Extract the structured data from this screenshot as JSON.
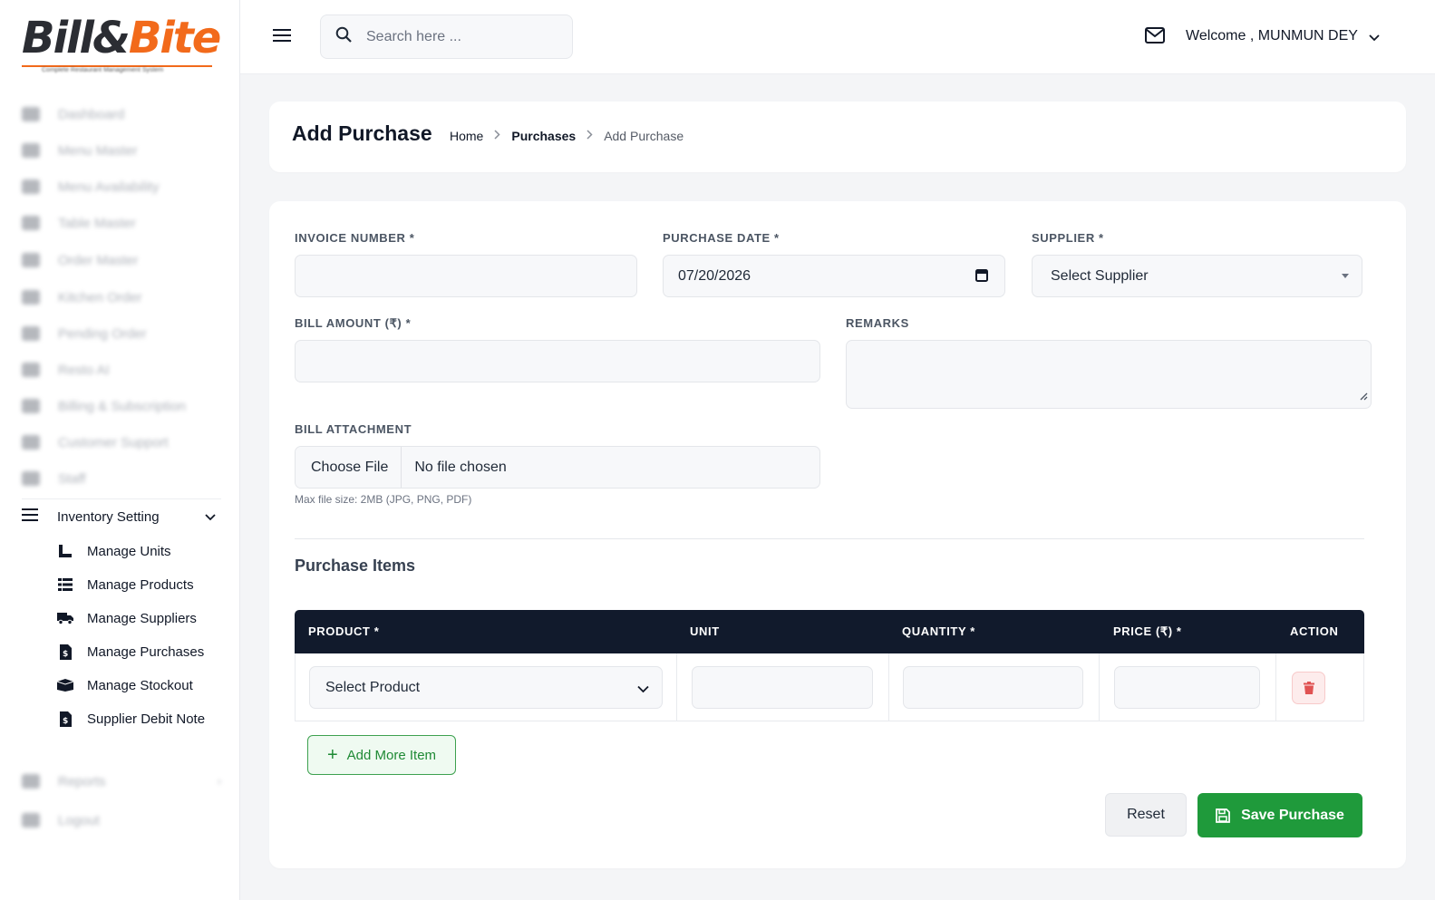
{
  "brand": {
    "word1": "Bill&",
    "word2": "Bite",
    "tagline": "Complete Restaurant Management System"
  },
  "sidebar": {
    "items": [
      {
        "label": "Dashboard",
        "icon": "dashboard-icon"
      },
      {
        "label": "Menu Master",
        "icon": "menu-icon"
      },
      {
        "label": "Menu Availability",
        "icon": "availability-icon"
      },
      {
        "label": "Table Master",
        "icon": "table-icon"
      },
      {
        "label": "Order Master",
        "icon": "order-icon"
      },
      {
        "label": "Kitchen Order",
        "icon": "kitchen-icon"
      },
      {
        "label": "Pending Order",
        "icon": "pending-icon"
      },
      {
        "label": "Resto AI",
        "icon": "ai-icon"
      },
      {
        "label": "Billing & Subscription",
        "icon": "billing-icon"
      },
      {
        "label": "Customer Support",
        "icon": "support-icon"
      },
      {
        "label": "Staff",
        "icon": "staff-icon"
      }
    ],
    "inventory": {
      "label": "Inventory Setting",
      "subitems": [
        {
          "label": "Manage Units",
          "icon": "ruler-icon"
        },
        {
          "label": "Manage Products",
          "icon": "list-icon"
        },
        {
          "label": "Manage Suppliers",
          "icon": "truck-icon"
        },
        {
          "label": "Manage Purchases",
          "icon": "invoice-icon"
        },
        {
          "label": "Manage Stockout",
          "icon": "box-icon"
        },
        {
          "label": "Supplier Debit Note",
          "icon": "invoice-icon"
        }
      ]
    },
    "bottom_items": [
      {
        "label": "Reports",
        "icon": "reports-icon"
      },
      {
        "label": "Logout",
        "icon": "logout-icon"
      }
    ]
  },
  "topbar": {
    "search_placeholder": "Search here ...",
    "welcome": "Welcome , MUNMUN DEY"
  },
  "page": {
    "title": "Add Purchase",
    "breadcrumb": [
      "Home",
      "Purchases",
      "Add Purchase"
    ]
  },
  "form": {
    "invoice_label": "INVOICE NUMBER *",
    "invoice_value": "",
    "date_label": "PURCHASE DATE *",
    "date_value": "07/20/2026",
    "supplier_label": "SUPPLIER *",
    "supplier_value": "Select Supplier",
    "bill_amount_label": "BILL AMOUNT (₹) *",
    "bill_amount_value": "",
    "remarks_label": "REMARKS",
    "attachment_label": "BILL ATTACHMENT",
    "choose_file": "Choose File",
    "no_file": "No file chosen",
    "file_hint": "Max file size: 2MB (JPG, PNG, PDF)"
  },
  "items": {
    "section_title": "Purchase Items",
    "columns": [
      "PRODUCT *",
      "UNIT",
      "QUANTITY *",
      "PRICE (₹) *",
      "ACTION"
    ],
    "rows": [
      {
        "product": "Select Product",
        "unit": "",
        "quantity": "",
        "price": ""
      }
    ],
    "add_more": "Add More Item"
  },
  "actions": {
    "reset": "Reset",
    "save": "Save Purchase"
  },
  "colors": {
    "accent": "#1f9a3b",
    "brand_orange": "#f26a1b",
    "table_header": "#111a2c",
    "danger": "#e05252"
  }
}
